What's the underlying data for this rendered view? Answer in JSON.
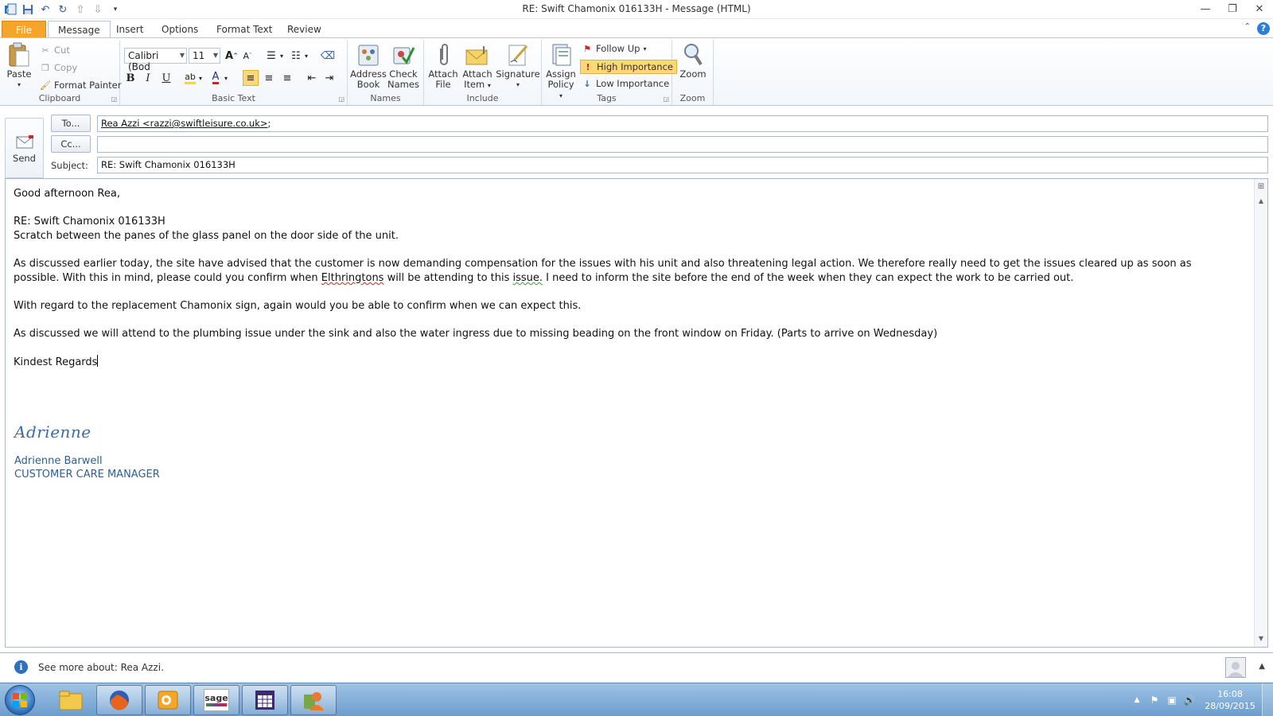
{
  "window": {
    "title": "RE: Swift Chamonix 016133H  - Message (HTML)"
  },
  "tabs": {
    "file": "File",
    "message": "Message",
    "insert": "Insert",
    "options": "Options",
    "format_text": "Format Text",
    "review": "Review"
  },
  "ribbon": {
    "clipboard": {
      "label": "Clipboard",
      "paste": "Paste",
      "cut": "Cut",
      "copy": "Copy",
      "format_painter": "Format Painter"
    },
    "basic_text": {
      "label": "Basic Text",
      "font_name": "Calibri (Bod",
      "font_size": "11"
    },
    "names": {
      "label": "Names",
      "address_book_1": "Address",
      "address_book_2": "Book",
      "check_names_1": "Check",
      "check_names_2": "Names"
    },
    "include": {
      "label": "Include",
      "attach_file_1": "Attach",
      "attach_file_2": "File",
      "attach_item_1": "Attach",
      "attach_item_2": "Item",
      "signature": "Signature"
    },
    "tags": {
      "label": "Tags",
      "assign_policy_1": "Assign",
      "assign_policy_2": "Policy",
      "follow_up": "Follow Up",
      "high_importance": "High Importance",
      "low_importance": "Low Importance"
    },
    "zoom": {
      "label": "Zoom",
      "zoom": "Zoom"
    }
  },
  "header": {
    "send": "Send",
    "to_button": "To...",
    "cc_button": "Cc...",
    "subject_label": "Subject:",
    "to_value": "Rea Azzi <razzi@swiftleisure.co.uk>",
    "to_suffix": ";",
    "cc_value": "",
    "subject_value": "RE: Swift Chamonix 016133H"
  },
  "body": {
    "greeting": "Good afternoon Rea,",
    "ref_line": "RE: Swift Chamonix 016133H",
    "issue_line": "Scratch between the panes of the glass panel on the door side of the unit.",
    "para1_a": "As discussed earlier today, the site have advised that the customer is now demanding compensation for the issues with his unit and also threatening legal action.  We therefore really need to get the issues cleared up as soon as possible.  With this in mind, please could you confirm when ",
    "para1_word_misspelled": "Elthringtons",
    "para1_b": " will be attending to this ",
    "para1_word_grammar": "issue.",
    "para1_c": "  I need to inform the site before the end of the week when they can expect the work to be carried out.",
    "para2": "With regard to the replacement Chamonix sign, again would you be able to confirm when we can expect this.",
    "para3": "As discussed we will attend to the plumbing issue under the sink and also the water ingress due to missing beading on the front window on Friday.  (Parts to arrive on Wednesday)",
    "closing": "Kindest Regards",
    "signature_script": "Adrienne",
    "signature_name": "Adrienne Barwell",
    "signature_title": "CUSTOMER CARE MANAGER"
  },
  "people_pane": {
    "text": "See more about: Rea Azzi."
  },
  "taskbar": {
    "time": "16:08",
    "date": "28/09/2015",
    "sage_label": "sage"
  },
  "colors": {
    "file_tab": "#f4a52a",
    "high_importance_bg": "#fbd977",
    "signature": "#2f5f8f",
    "taskbar": "#7aa7d6"
  }
}
